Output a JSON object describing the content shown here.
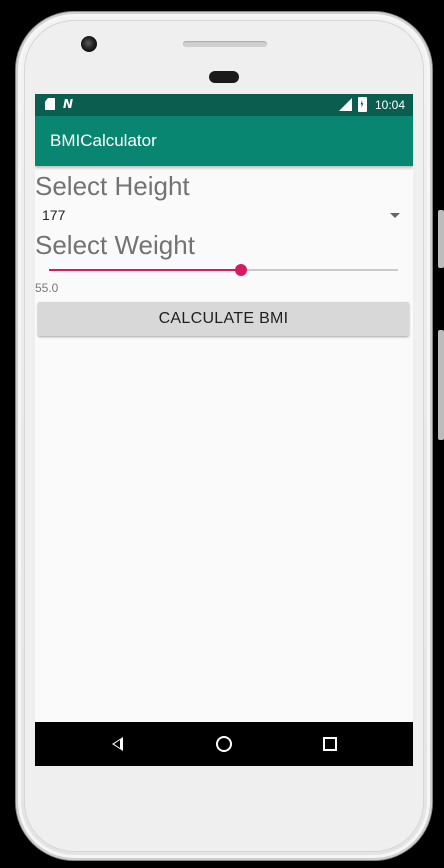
{
  "status_bar": {
    "time": "10:04",
    "left_icons": [
      "sd-card-icon",
      "n-icon"
    ],
    "right_icons": [
      "signal-lte-icon",
      "battery-icon"
    ],
    "color": "#0b5e4f"
  },
  "app_bar": {
    "title": "BMICalculator",
    "color": "#098672"
  },
  "height_section": {
    "label": "Select Height",
    "selected_value": "177"
  },
  "weight_section": {
    "label": "Select Weight",
    "slider_fraction": 0.55,
    "value_text": "55.0",
    "accent": "#d81b60"
  },
  "calculate_button": {
    "label": "CALCULATE BMI"
  },
  "nav_bar": {
    "buttons": [
      "back-icon",
      "home-icon",
      "recent-apps-icon"
    ]
  }
}
